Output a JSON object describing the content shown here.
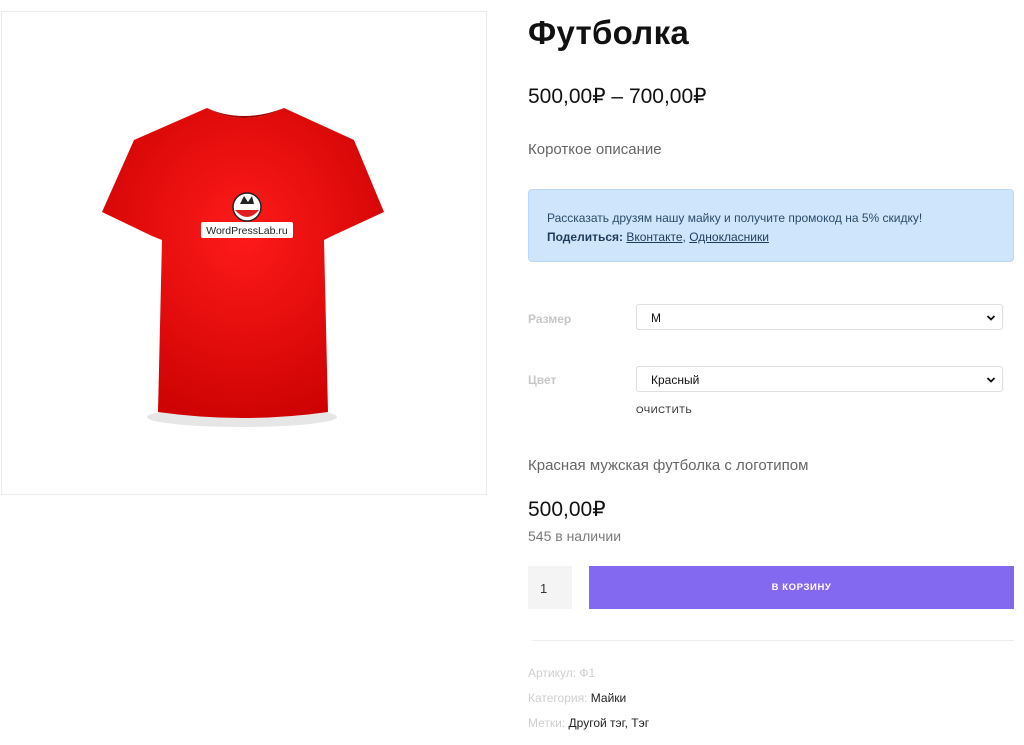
{
  "product": {
    "title": "Футболка",
    "price_range": "500,00₽ – 700,00₽",
    "short_description": "Короткое описание",
    "image_logo_text": "WordPressLab.ru",
    "shirt_color": "#ee0d0d"
  },
  "notice": {
    "text": "Рассказать друзям нашу майку и получите промокод на 5% скидку!",
    "share_label": "Поделиться:",
    "links": [
      "Вконтакте",
      "Однокласники"
    ],
    "separator": ","
  },
  "attributes": {
    "size": {
      "label": "Размер",
      "value": "M"
    },
    "color": {
      "label": "Цвет",
      "value": "Красный"
    },
    "reset_label": "ОЧИСТИТЬ"
  },
  "variation": {
    "description": "Красная мужская футболка с логотипом",
    "price": "500,00₽",
    "stock": "545 в наличии"
  },
  "cart": {
    "quantity": "1",
    "button_label": "В КОРЗИНУ",
    "button_color": "#8369f0"
  },
  "meta": {
    "sku_label": "Артикул:",
    "sku_value": "Ф1",
    "category_label": "Категория:",
    "category_value": "Майки",
    "tags_label": "Метки:",
    "tags": [
      "Другой тэг",
      "Тэг"
    ],
    "tag_separator": ","
  }
}
